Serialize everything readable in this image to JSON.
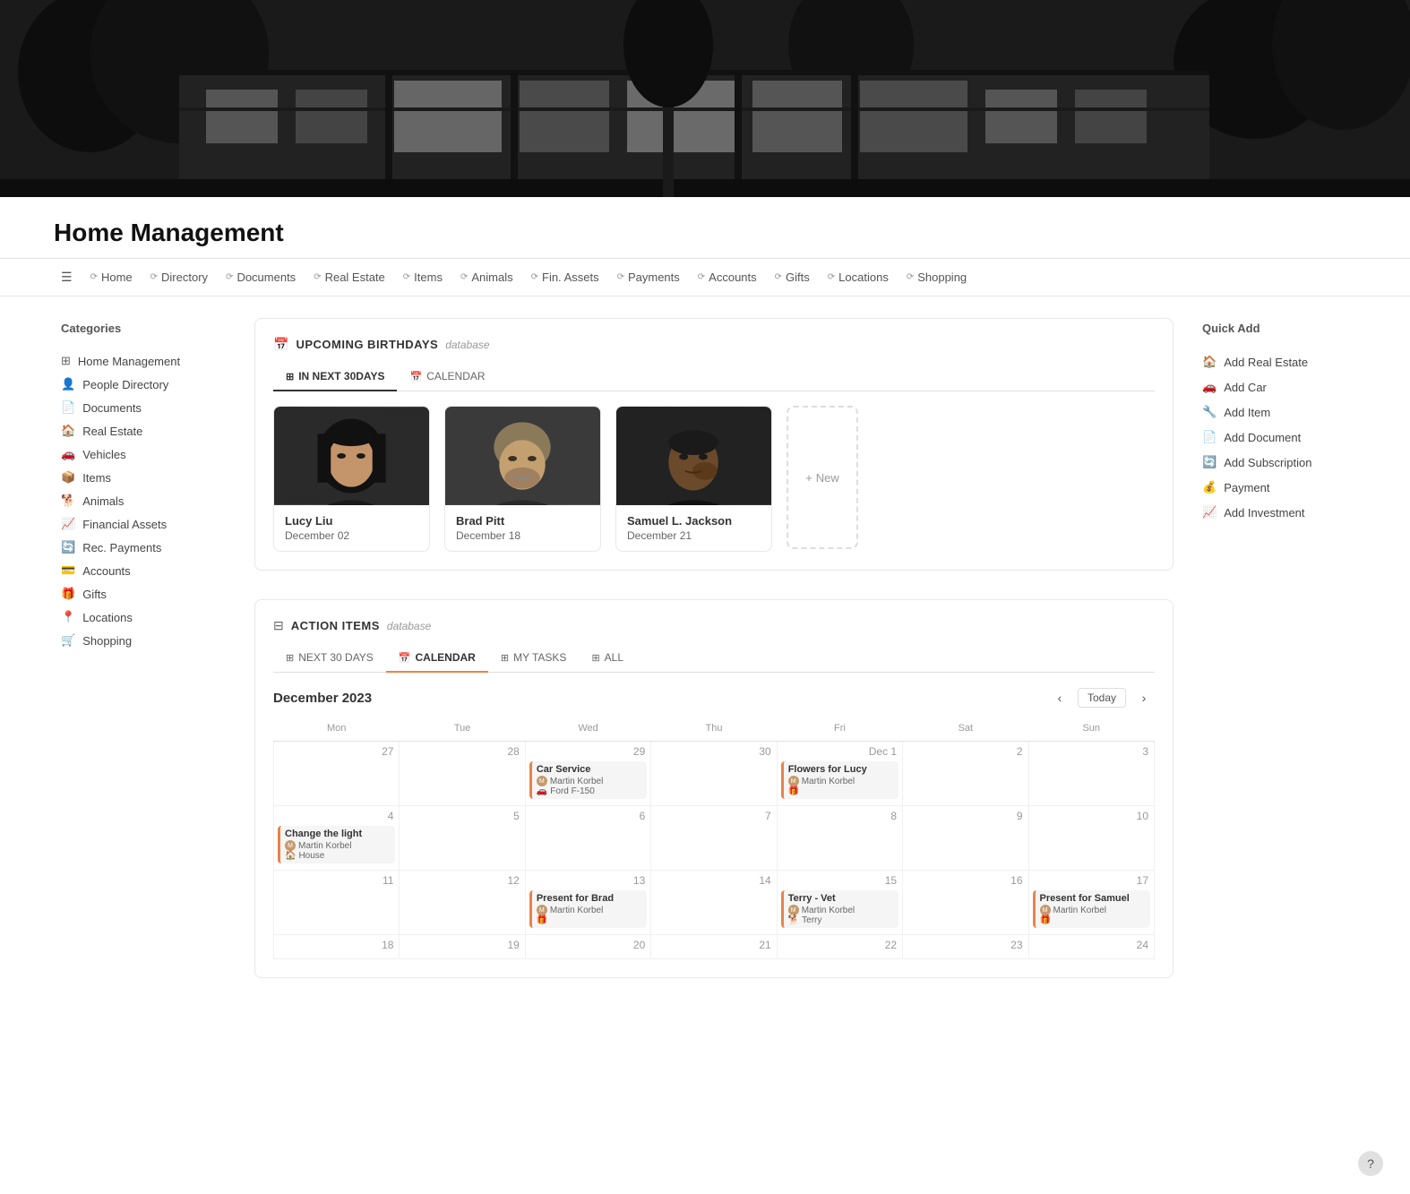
{
  "page": {
    "title": "Home Management"
  },
  "nav": {
    "items": [
      {
        "label": "Home",
        "icon": "⟳"
      },
      {
        "label": "Directory",
        "icon": "⟳"
      },
      {
        "label": "Documents",
        "icon": "⟳"
      },
      {
        "label": "Real Estate",
        "icon": "⟳"
      },
      {
        "label": "Items",
        "icon": "⟳"
      },
      {
        "label": "Animals",
        "icon": "⟳"
      },
      {
        "label": "Fin. Assets",
        "icon": "⟳"
      },
      {
        "label": "Payments",
        "icon": "⟳"
      },
      {
        "label": "Accounts",
        "icon": "⟳"
      },
      {
        "label": "Gifts",
        "icon": "⟳"
      },
      {
        "label": "Locations",
        "icon": "⟳"
      },
      {
        "label": "Shopping",
        "icon": "⟳"
      }
    ]
  },
  "sidebar": {
    "title": "Categories",
    "items": [
      {
        "label": "Home Management",
        "icon": "⊞"
      },
      {
        "label": "People Directory",
        "icon": "👤"
      },
      {
        "label": "Documents",
        "icon": "📄"
      },
      {
        "label": "Real Estate",
        "icon": "🏠"
      },
      {
        "label": "Vehicles",
        "icon": "🚗"
      },
      {
        "label": "Items",
        "icon": "📦"
      },
      {
        "label": "Animals",
        "icon": "🐕"
      },
      {
        "label": "Financial Assets",
        "icon": "📈"
      },
      {
        "label": "Rec. Payments",
        "icon": "🔄"
      },
      {
        "label": "Accounts",
        "icon": "💳"
      },
      {
        "label": "Gifts",
        "icon": "🎁"
      },
      {
        "label": "Locations",
        "icon": "📍"
      },
      {
        "label": "Shopping",
        "icon": "🛒"
      }
    ]
  },
  "quick_add": {
    "title": "Quick Add",
    "items": [
      {
        "label": "Add Real Estate",
        "icon": "🏠"
      },
      {
        "label": "Add Car",
        "icon": "🚗"
      },
      {
        "label": "Add Item",
        "icon": "🔧"
      },
      {
        "label": "Add Document",
        "icon": "📄"
      },
      {
        "label": "Add Subscription",
        "icon": "🔄"
      },
      {
        "label": "Payment",
        "icon": "💰"
      },
      {
        "label": "Add Investment",
        "icon": "📈"
      }
    ]
  },
  "birthdays": {
    "section_title": "UPCOMING BIRTHDAYS",
    "db_label": "database",
    "tabs": [
      {
        "label": "IN NEXT 30DAYS",
        "icon": "⊞",
        "active": true
      },
      {
        "label": "CALENDAR",
        "icon": "📅",
        "active": false
      }
    ],
    "people": [
      {
        "name": "Lucy Liu",
        "date": "December 02"
      },
      {
        "name": "Brad Pitt",
        "date": "December 18"
      },
      {
        "name": "Samuel L. Jackson",
        "date": "December 21"
      }
    ]
  },
  "action_items": {
    "section_title": "ACTION ITEMS",
    "db_label": "database",
    "tabs": [
      {
        "label": "NEXT 30 DAYS",
        "icon": "⊞",
        "active": false
      },
      {
        "label": "CALENDAR",
        "icon": "📅",
        "active": true
      },
      {
        "label": "MY TASKS",
        "icon": "⊞",
        "active": false
      },
      {
        "label": "ALL",
        "icon": "⊞",
        "active": false
      }
    ],
    "calendar": {
      "month": "December 2023",
      "today_label": "Today",
      "days_of_week": [
        "Mon",
        "Tue",
        "Wed",
        "Thu",
        "Fri",
        "Sat",
        "Sun"
      ],
      "weeks": [
        {
          "days": [
            {
              "num": "27",
              "prev": true,
              "events": []
            },
            {
              "num": "28",
              "prev": true,
              "events": []
            },
            {
              "num": "29",
              "prev": true,
              "events": [
                {
                  "title": "Car Service",
                  "person": "Martin Korbel",
                  "tag": "Ford F-150"
                }
              ]
            },
            {
              "num": "30",
              "prev": true,
              "events": []
            },
            {
              "num": "Dec 1",
              "today": false,
              "events": [
                {
                  "title": "Flowers for Lucy",
                  "person": "Martin Korbel",
                  "tag": ""
                }
              ]
            },
            {
              "num": "2",
              "events": []
            },
            {
              "num": "3",
              "events": []
            }
          ]
        },
        {
          "days": [
            {
              "num": "4",
              "events": [
                {
                  "title": "Change the light",
                  "person": "Martin Korbel",
                  "tag": "House"
                }
              ]
            },
            {
              "num": "5",
              "events": []
            },
            {
              "num": "6",
              "events": []
            },
            {
              "num": "7",
              "events": []
            },
            {
              "num": "8",
              "events": []
            },
            {
              "num": "9",
              "events": []
            },
            {
              "num": "10",
              "events": []
            }
          ]
        },
        {
          "days": [
            {
              "num": "11",
              "events": []
            },
            {
              "num": "12",
              "events": []
            },
            {
              "num": "13",
              "events": [
                {
                  "title": "Present for Brad",
                  "person": "Martin Korbel",
                  "tag": ""
                }
              ]
            },
            {
              "num": "14",
              "events": []
            },
            {
              "num": "15",
              "events": [
                {
                  "title": "Terry - Vet",
                  "person": "Martin Korbel",
                  "tag": "Terry"
                }
              ]
            },
            {
              "num": "16",
              "events": []
            },
            {
              "num": "17",
              "events": [
                {
                  "title": "Present for Samuel",
                  "person": "Martin Korbel",
                  "tag": ""
                }
              ]
            }
          ]
        },
        {
          "days": [
            {
              "num": "18",
              "events": []
            },
            {
              "num": "19",
              "events": []
            },
            {
              "num": "20",
              "events": []
            },
            {
              "num": "21",
              "events": []
            },
            {
              "num": "22",
              "events": []
            },
            {
              "num": "23",
              "events": []
            },
            {
              "num": "24",
              "events": []
            }
          ]
        }
      ]
    }
  }
}
